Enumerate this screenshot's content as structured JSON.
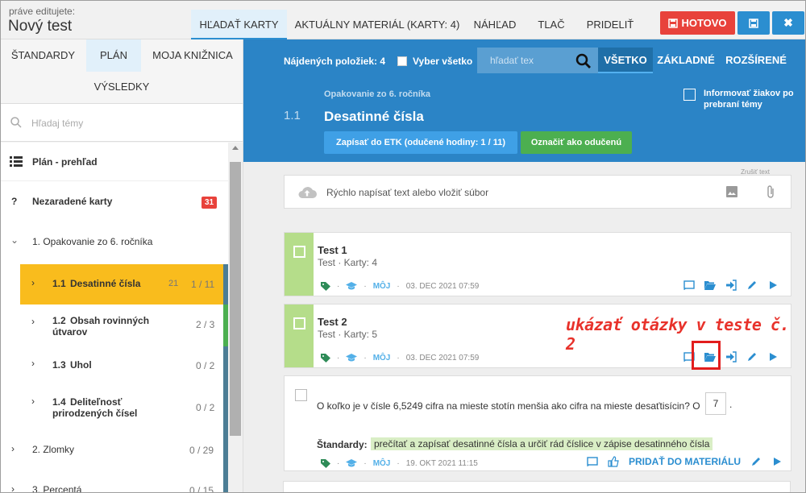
{
  "header": {
    "edit_label": "práve editujete:",
    "test_name": "Nový test",
    "tabs": [
      {
        "label": "HĽADAŤ KARTY"
      },
      {
        "label": "AKTUÁLNY MATERIÁL (KARTY: 4)"
      },
      {
        "label": "NÁHĽAD"
      },
      {
        "label": "TLAČ"
      },
      {
        "label": "PRIDELIŤ"
      }
    ],
    "done_label": "HOTOVO"
  },
  "left": {
    "tabs": [
      {
        "label": "ŠTANDARDY"
      },
      {
        "label": "PLÁN"
      },
      {
        "label": "MOJA KNIŽNICA"
      },
      {
        "label": "VÝSLEDKY"
      }
    ],
    "search_placeholder": "Hľadaj témy",
    "items": [
      {
        "label": "Plán - prehľad"
      },
      {
        "label": "Nezaradené karty",
        "badge": "31"
      },
      {
        "label": "1. Opakovanie zo 6. ročníka"
      },
      {
        "num": "1.1",
        "label": "Desatinné čísla",
        "count_a": "21",
        "count": "1 / 11"
      },
      {
        "num": "1.2",
        "label": "Obsah rovinných",
        "label2": "útvarov",
        "count": "2 / 3"
      },
      {
        "num": "1.3",
        "label": "Uhol",
        "count": "0 / 2"
      },
      {
        "num": "1.4",
        "label": "Deliteľnosť",
        "label2": "prirodzených čísel",
        "count": "0 / 2"
      },
      {
        "label": "2. Zlomky",
        "count": "0 / 29"
      },
      {
        "label": "3. Percentá",
        "count": "0 / 15"
      }
    ]
  },
  "main": {
    "found": "Nájdených položiek: 4",
    "select_all": "Vyber všetko",
    "search_placeholder": "hľadať tex",
    "filters": [
      {
        "label": "VŠETKO"
      },
      {
        "label": "ZÁKLADNÉ"
      },
      {
        "label": "ROZŠÍRENÉ"
      }
    ],
    "inform": "Informovať žiakov po prebraní témy",
    "section_parent": "Opakovanie zo 6. ročníka",
    "section_num": "1.1",
    "section_title": "Desatinné čísla",
    "etk_label": "Zapísať do ETK (odučené hodiny: 1 / 11)",
    "taught_label": "Označiť ako odučenú",
    "quick_placeholder": "Rýchlo napísať text alebo vložiť súbor",
    "quick_hint": "Zrušiť text",
    "cards": [
      {
        "title": "Test 1",
        "sub": "Test · Karty: 4",
        "owner": "MÔJ",
        "date": "03. DEC 2021 07:59"
      },
      {
        "title": "Test 2",
        "sub": "Test · Karty: 5",
        "owner": "MÔJ",
        "date": "03. DEC 2021 07:59"
      }
    ],
    "question": {
      "text": "O koľko je v čísle 6,5249 cifra na mieste stotín menšia ako cifra na mieste desaťtisícin? O",
      "answer": "7",
      "after": ".",
      "standard_label": "Štandardy:",
      "standard": "prečítať a zapísať desatinné čísla a určiť rád číslice v zápise desatinného čísla",
      "owner": "MÔJ",
      "date": "19. OKT 2021 11:15",
      "add_label": "PRIDAŤ DO MATERIÁLU"
    }
  },
  "annotation": "ukázať otázky v teste č. 2",
  "colors": {
    "accent": "#2b84c6",
    "danger": "#e8423b",
    "success": "#4caf50",
    "highlight": "#f9bc1d",
    "strip": "#b5dd8a"
  }
}
